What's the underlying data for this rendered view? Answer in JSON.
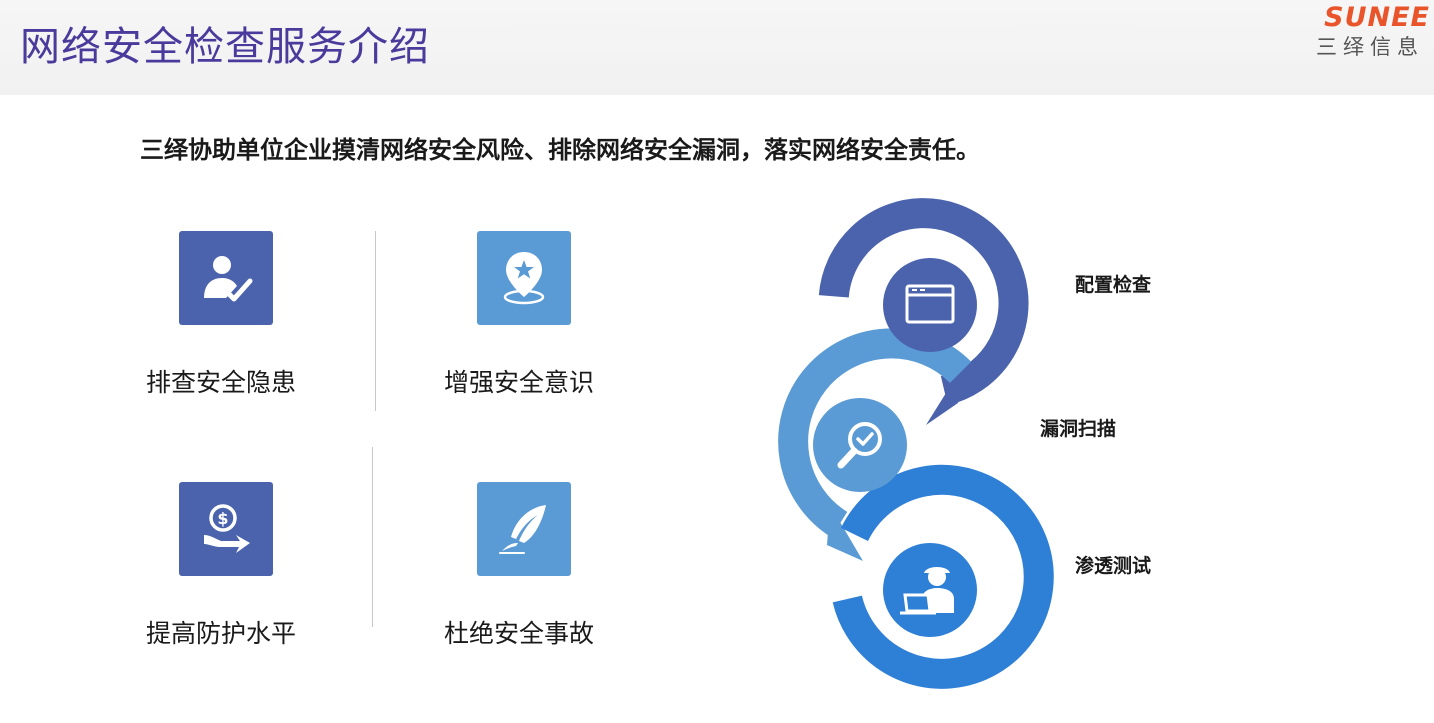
{
  "header": {
    "title": "网络安全检查服务介绍",
    "logo_en": "SUNEE",
    "logo_cn": "三绎信息"
  },
  "subtitle": "三绎协助单位企业摸清网络安全风险、排除网络安全漏洞，落实网络安全责任。",
  "features": [
    {
      "label": "排查安全隐患",
      "icon": "user-check-icon"
    },
    {
      "label": "增强安全意识",
      "icon": "location-star-icon"
    },
    {
      "label": "提高防护水平",
      "icon": "money-hand-icon"
    },
    {
      "label": "杜绝安全事故",
      "icon": "feather-pen-icon"
    }
  ],
  "steps": [
    {
      "label": "配置检查",
      "icon": "browser-window-icon"
    },
    {
      "label": "漏洞扫描",
      "icon": "magnifier-check-icon"
    },
    {
      "label": "渗透测试",
      "icon": "worker-laptop-icon"
    }
  ],
  "colors": {
    "title": "#4a3a9c",
    "logo_orange": "#e9542a",
    "ring_dark": "#4a63ac",
    "ring_light": "#5b9bd5",
    "ring_blue": "#2e7fd6"
  }
}
